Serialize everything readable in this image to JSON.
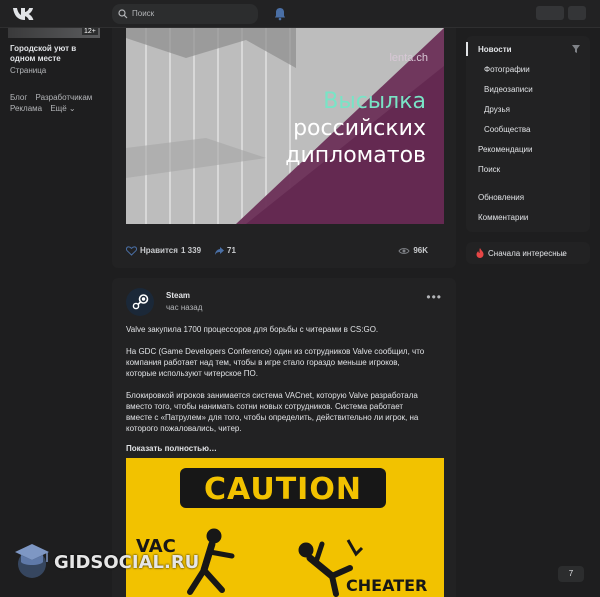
{
  "header": {
    "logo_name": "vk-logo",
    "search_placeholder": "Поиск"
  },
  "left_nav": {
    "age_badge": "12+",
    "community_title": "Городской уют в одном месте",
    "community_sub": "Страница",
    "links": [
      "Блог",
      "Разработчикам",
      "Реклама",
      "Ещё ⌄"
    ]
  },
  "post1": {
    "source_watermark": "lenta.ch",
    "headline": [
      "Высылка",
      "российских",
      "дипломатов"
    ],
    "headline_accent": "#79e4c6",
    "likes_label": "Нравится",
    "likes_count": "1 339",
    "shares_count": "71",
    "views": "96K"
  },
  "post2": {
    "author": "Steam",
    "time": "час назад",
    "paragraphs": [
      "Valve закупила 1700 процессоров для борьбы с читерами в CS:GO.",
      "На GDC (Game Developers Conference) один из сотрудников Valve сообщил, что компания работает над тем, чтобы в игре стало гораздо меньше игроков, которые используют читерское ПО.",
      "Блокировкой игроков занимается система VACnet, которую Valve разработала вместо того, чтобы нанимать сотни новых сотрудников. Система работает вместе с «Патрулем» для того, чтобы определить, действительно ли игрок, на которого пожаловались, читер."
    ],
    "show_more": "Показать полностью…",
    "image_texts": {
      "caution": "CAUTION",
      "vac": "VAC",
      "cheater": "CHEATER"
    }
  },
  "right_menu": {
    "items": [
      {
        "label": "Новости",
        "active": true
      },
      {
        "label": "Фотографии",
        "sub": true
      },
      {
        "label": "Видеозаписи",
        "sub": true
      },
      {
        "label": "Друзья",
        "sub": true
      },
      {
        "label": "Сообщества",
        "sub": true
      },
      {
        "label": "Рекомендации"
      },
      {
        "label": "Поиск"
      },
      {
        "label": "Обновления"
      },
      {
        "label": "Комментарии"
      }
    ],
    "sort_label": "Сначала интересные"
  },
  "counter": "7",
  "watermark": "GIDSOCIAL.RU"
}
